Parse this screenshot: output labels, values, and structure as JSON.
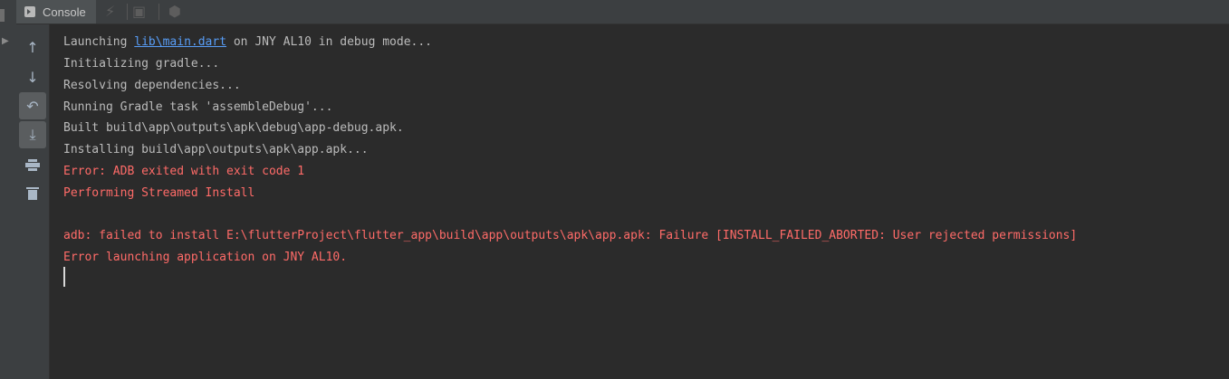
{
  "tab": {
    "label": "Console"
  },
  "icons": {
    "console_tab": "console-icon",
    "flash": "flash-icon",
    "debug_attach": "debug-icon",
    "stop": "stop-icon",
    "scroll_up": "arrow-up-icon",
    "scroll_down": "arrow-down-icon",
    "soft_wrap": "soft-wrap-icon",
    "scroll_to_end": "scroll-to-end-icon",
    "print": "print-icon",
    "clear": "trash-icon"
  },
  "colors": {
    "background": "#2b2b2b",
    "panel": "#3c3f41",
    "text": "#bbbbbb",
    "error": "#ff6b68",
    "link": "#589df6"
  },
  "console": {
    "line1": {
      "prefix": "Launching ",
      "link": "lib\\main.dart",
      "suffix": " on JNY AL10 in debug mode..."
    },
    "lines": [
      "Initializing gradle...",
      "Resolving dependencies...",
      "Running Gradle task 'assembleDebug'...",
      "Built build\\app\\outputs\\apk\\debug\\app-debug.apk.",
      "Installing build\\app\\outputs\\apk\\app.apk..."
    ],
    "errors": [
      "Error: ADB exited with exit code 1",
      "Performing Streamed Install",
      "adb: failed to install E:\\flutterProject\\flutter_app\\build\\app\\outputs\\apk\\app.apk: Failure [INSTALL_FAILED_ABORTED: User rejected permissions]",
      "Error launching application on JNY AL10."
    ]
  }
}
